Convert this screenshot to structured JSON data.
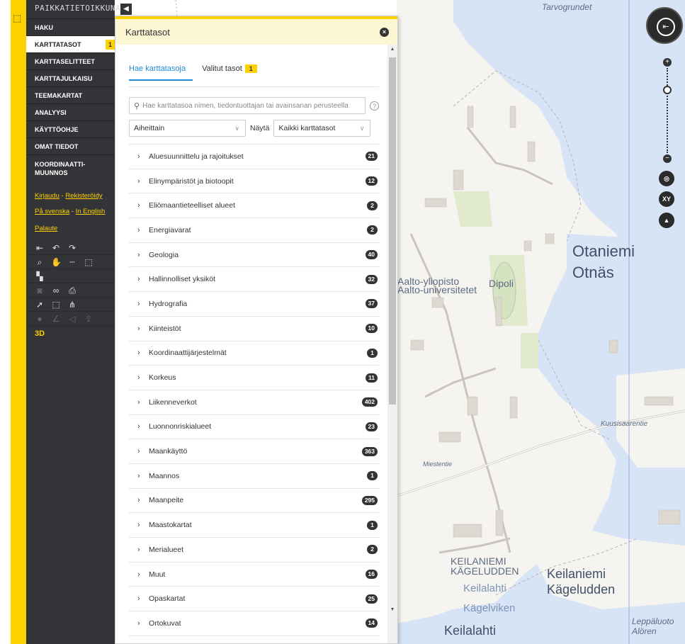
{
  "sidebar": {
    "title": "PAIKKATIETOIKKUNA",
    "items": [
      {
        "label": "HAKU"
      },
      {
        "label": "KARTTATASOT",
        "badge": "1"
      },
      {
        "label": "KARTTASELITTEET"
      },
      {
        "label": "KARTTAJULKAISU"
      },
      {
        "label": "TEEMAKARTAT"
      },
      {
        "label": "ANALYYSI"
      },
      {
        "label": "KÄYTTÖOHJE"
      },
      {
        "label": "OMAT TIEDOT"
      },
      {
        "label": "KOORDINAATTI-\nMUUNNOS"
      }
    ],
    "links": {
      "login": "Kirjaudu",
      "register": "Rekisteröidy",
      "swedish": "På svenska",
      "english": "In English",
      "feedback": "Palaute",
      "dash": "-"
    },
    "three_d": "3D"
  },
  "panel": {
    "title": "Karttatasot",
    "tabs": [
      {
        "label": "Hae karttatasoja"
      },
      {
        "label": "Valitut tasot",
        "badge": "1"
      }
    ],
    "search_placeholder": "Hae karttatasoa nimen, tiedontuottajan tai avainsanan perusteella",
    "filter_select": "Aiheittain",
    "show_label": "Näytä",
    "show_select": "Kaikki karttatasot",
    "groups": [
      {
        "label": "Aluesuunnittelu ja rajoitukset",
        "count": "21"
      },
      {
        "label": "Elinympäristöt ja biotoopit",
        "count": "12"
      },
      {
        "label": "Eliömaantieteelliset alueet",
        "count": "2"
      },
      {
        "label": "Energiavarat",
        "count": "2"
      },
      {
        "label": "Geologia",
        "count": "40"
      },
      {
        "label": "Hallinnolliset yksiköt",
        "count": "32"
      },
      {
        "label": "Hydrografia",
        "count": "37"
      },
      {
        "label": "Kiinteistöt",
        "count": "10"
      },
      {
        "label": "Koordinaattijärjestelmät",
        "count": "1"
      },
      {
        "label": "Korkeus",
        "count": "11"
      },
      {
        "label": "Liikenneverkot",
        "count": "402"
      },
      {
        "label": "Luonnonriskialueet",
        "count": "23"
      },
      {
        "label": "Maankäyttö",
        "count": "363"
      },
      {
        "label": "Maannos",
        "count": "1"
      },
      {
        "label": "Maanpeite",
        "count": "295"
      },
      {
        "label": "Maastokartat",
        "count": "1"
      },
      {
        "label": "Merialueet",
        "count": "2"
      },
      {
        "label": "Muut",
        "count": "16"
      },
      {
        "label": "Opaskartat",
        "count": "25"
      },
      {
        "label": "Ortokuvat",
        "count": "14"
      }
    ]
  },
  "map": {
    "labels": {
      "tarvogrundet": "Tarvogrundet",
      "otaniemi": "Otaniemi",
      "otnas": "Otnäs",
      "aalto_fi": "Aalto-yliopisto",
      "aalto_sv": "Aalto-universitetet",
      "dipoli": "Dipoli",
      "keilaniemi_caps": "KEILANIEMI",
      "kageludden_caps": "KÄGELUDDEN",
      "keilaniemi": "Keilaniemi",
      "kageludden": "Kägeludden",
      "keilalahti_w": "Keilalahti",
      "kagelviken": "Kägelviken",
      "keilalahti": "Keilalahti",
      "leppaluoto": "Leppäluoto",
      "aloren": "Alören",
      "kuusisaarentie": "Kuusisaarentie",
      "miestentie": "Miestentie"
    },
    "controls": {
      "xy": "XY"
    }
  }
}
